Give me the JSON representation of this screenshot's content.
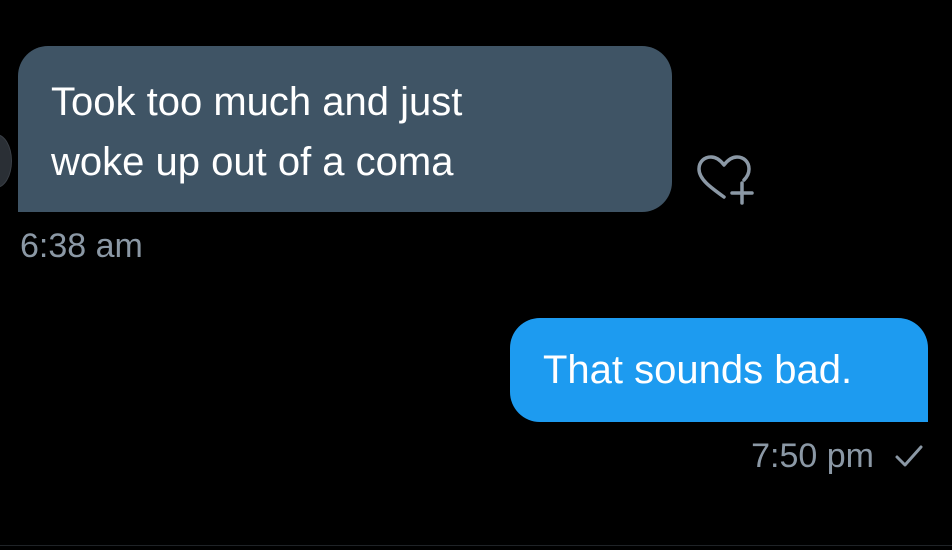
{
  "conversation": {
    "received_message": {
      "lines": [
        "Took too much and just",
        "woke up out of a coma"
      ],
      "time": "6:38 am",
      "like_icon": "heart-plus-icon"
    },
    "sent_message": {
      "text": "That sounds bad.",
      "time": "7:50 pm",
      "status_icon": "checkmark-icon"
    }
  },
  "colors": {
    "background": "#000000",
    "received_bubble": "#3f5465",
    "sent_bubble": "#1d9bf0",
    "meta_text": "#8b98a5"
  }
}
